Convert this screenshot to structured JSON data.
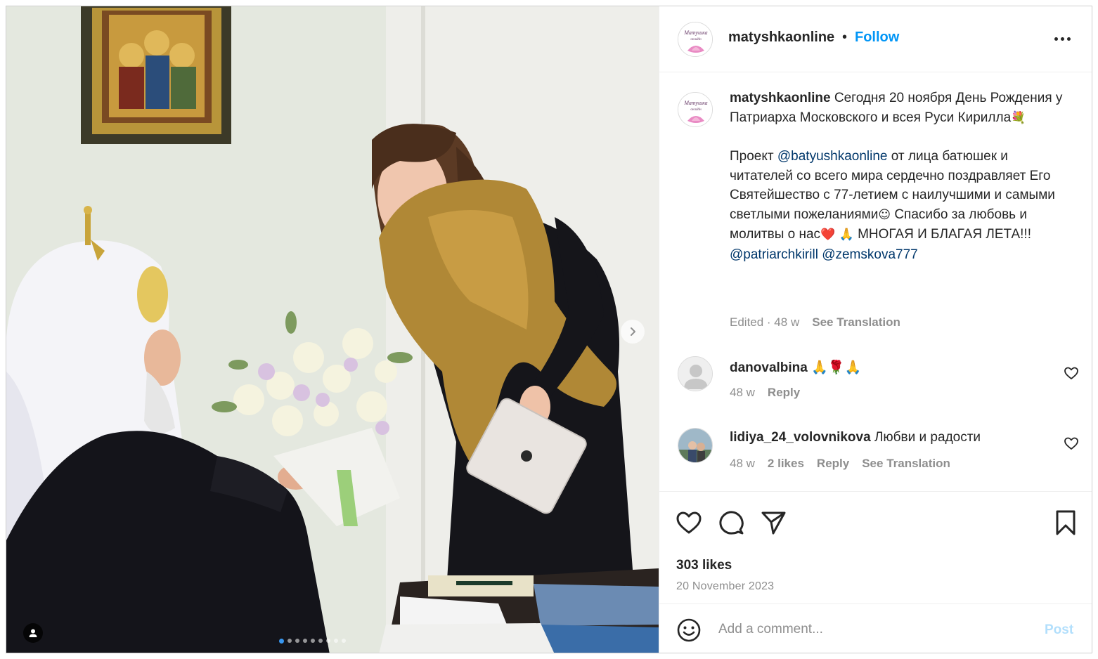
{
  "post": {
    "username": "matyshkaonline",
    "follow_label": "Follow",
    "separator": "•",
    "avatar_text": "Матушка онлайн"
  },
  "caption": {
    "username": "matyshkaonline",
    "line1": "Сегодня 20 ноября День Рождения у Патриарха Московского и всея Руси Кирилла",
    "line1_emoji": "💐",
    "para2_start": "Проект ",
    "mention1": "@batyushkaonline",
    "para2_rest": " от лица батюшек и читателей со всего мира сердечно поздравляет Его Святейшество с 77-летием с наилучшими и самыми светлыми пожеланиями",
    "emoji_smile": "☺",
    "para2_thanks": " Спасибо за любовь и молитвы о нас",
    "emoji_heart_pray": "❤️ 🙏",
    "para2_end": " МНОГАЯ И БЛАГАЯ ЛЕТА!!!",
    "mention2": "@patriarchkirill",
    "mention3": "@zemskova777",
    "edited": "Edited · 48 w",
    "see_translation": "See Translation"
  },
  "comments": [
    {
      "username": "danovalbina",
      "text": "🙏🌹🙏",
      "age": "48 w",
      "likes": "",
      "reply": "Reply",
      "see_translation": ""
    },
    {
      "username": "lidiya_24_volovnikova",
      "text": "Любви и радости",
      "age": "48 w",
      "likes": "2 likes",
      "reply": "Reply",
      "see_translation": "See Translation"
    }
  ],
  "actions": {
    "icons": [
      "heart-icon",
      "comment-icon",
      "share-icon",
      "bookmark-icon"
    ],
    "likes": "303 likes",
    "date": "20 November 2023"
  },
  "add_comment": {
    "placeholder": "Add a comment...",
    "post_label": "Post"
  },
  "carousel": {
    "total_slides": 9,
    "active_slide": 1
  },
  "colors": {
    "accent": "#0095f6",
    "mention": "#00376b",
    "muted": "#8e8e8e",
    "post_disabled": "#b2dffc"
  }
}
